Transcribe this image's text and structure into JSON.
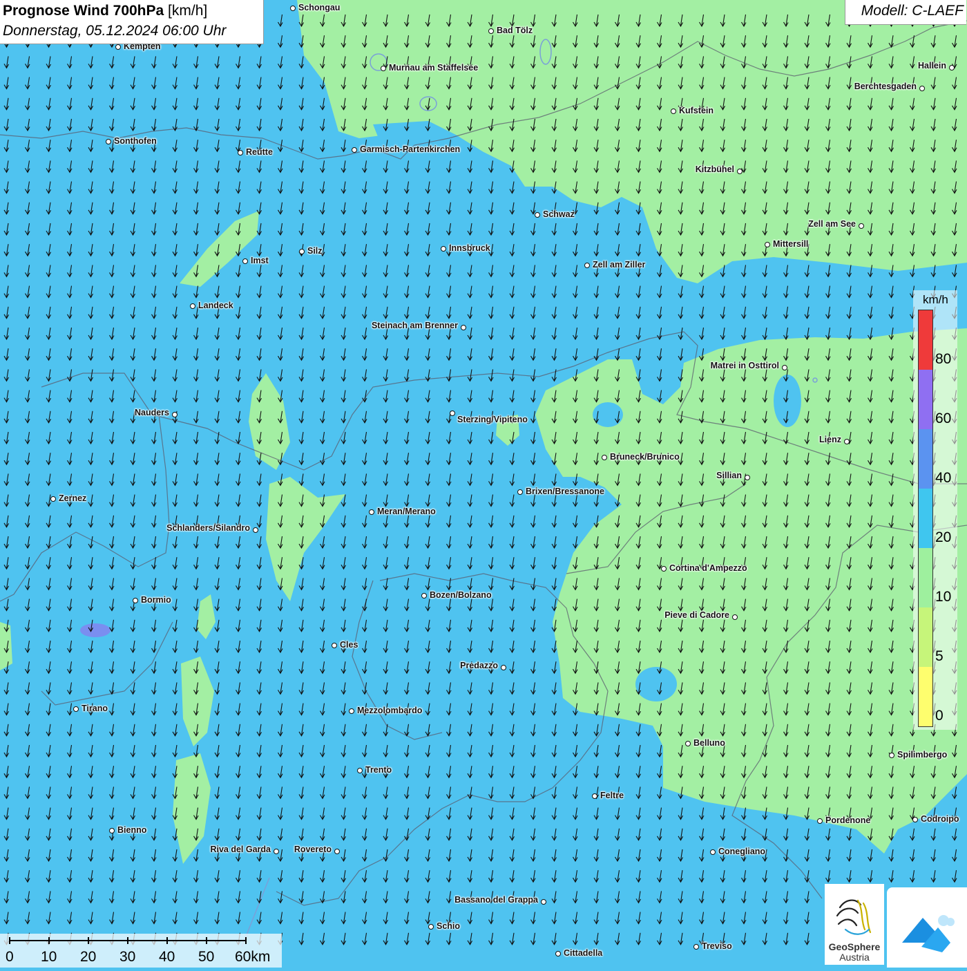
{
  "header": {
    "title_bold": "Prognose Wind 700hPa",
    "title_unit": "[km/h]",
    "datetime": "Donnerstag, 05.12.2024 06:00 Uhr",
    "model": "Modell: C-LAEF"
  },
  "legend": {
    "unit": "km/h",
    "classes": [
      {
        "label": "0",
        "color": "#fefe6e"
      },
      {
        "label": "5",
        "color": "#c6f57a"
      },
      {
        "label": "10",
        "color": "#9ef09e"
      },
      {
        "label": "20",
        "color": "#3fc6ef"
      },
      {
        "label": "40",
        "color": "#5b93f0"
      },
      {
        "label": "60",
        "color": "#8f6ff2"
      },
      {
        "label": "80",
        "color": "#ef3a3a"
      }
    ]
  },
  "scalebar": {
    "ticks": [
      "0",
      "10",
      "20",
      "30",
      "40",
      "50",
      "60km"
    ]
  },
  "cities": [
    {
      "name": "Schongau"
    },
    {
      "name": "Bad Tölz"
    },
    {
      "name": "Kempten"
    },
    {
      "name": "Murnau am Staffelsee"
    },
    {
      "name": "Hallein"
    },
    {
      "name": "Berchtesgaden"
    },
    {
      "name": "Kufstein"
    },
    {
      "name": "Sonthofen"
    },
    {
      "name": "Reutte"
    },
    {
      "name": "Garmisch-Partenkirchen"
    },
    {
      "name": "Kitzbühel"
    },
    {
      "name": "Schwaz"
    },
    {
      "name": "Zell am See"
    },
    {
      "name": "Innsbruck"
    },
    {
      "name": "Mittersill"
    },
    {
      "name": "Silz"
    },
    {
      "name": "Imst"
    },
    {
      "name": "Zell am Ziller"
    },
    {
      "name": "Landeck"
    },
    {
      "name": "Steinach am Brenner"
    },
    {
      "name": "Matrei in Osttirol"
    },
    {
      "name": "Nauders"
    },
    {
      "name": "Sterzing/Vipiteno"
    },
    {
      "name": "Lienz"
    },
    {
      "name": "Bruneck/Brunico"
    },
    {
      "name": "Sillian"
    },
    {
      "name": "Zernez"
    },
    {
      "name": "Brixen/Bressanone"
    },
    {
      "name": "Meran/Merano"
    },
    {
      "name": "Schlanders/Silandro"
    },
    {
      "name": "Cortina d'Ampezzo"
    },
    {
      "name": "Bozen/Bolzano"
    },
    {
      "name": "Bormio"
    },
    {
      "name": "Pieve di Cadore"
    },
    {
      "name": "Cles"
    },
    {
      "name": "Predazzo"
    },
    {
      "name": "Tirano"
    },
    {
      "name": "Mezzolombardo"
    },
    {
      "name": "Belluno"
    },
    {
      "name": "Spilimbergo"
    },
    {
      "name": "Trento"
    },
    {
      "name": "Feltre"
    },
    {
      "name": "Pordenone"
    },
    {
      "name": "Codroipo"
    },
    {
      "name": "Bienno"
    },
    {
      "name": "Riva del Garda"
    },
    {
      "name": "Rovereto"
    },
    {
      "name": "Conegliano"
    },
    {
      "name": "Bassano del Grappa"
    },
    {
      "name": "Schio"
    },
    {
      "name": "Treviso"
    },
    {
      "name": "Cittadella"
    }
  ],
  "logos": {
    "geosphere_line1": "GeoSphere",
    "geosphere_line2": "Austria"
  },
  "wind": {
    "predominant_direction": "N"
  }
}
